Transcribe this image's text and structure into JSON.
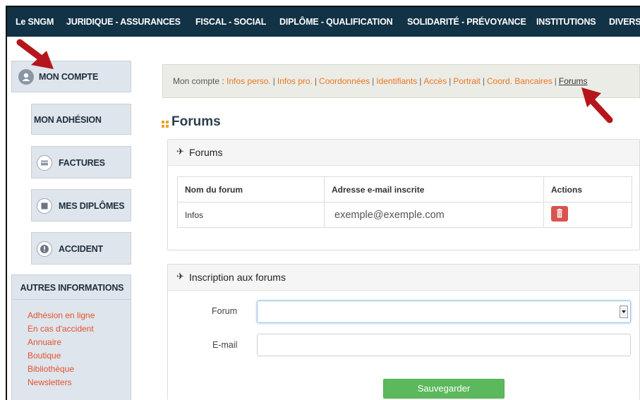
{
  "topnav": {
    "items": [
      "Le SNGM",
      "JURIDIQUE - ASSURANCES",
      "FISCAL - SOCIAL",
      "DIPLÔME - QUALIFICATION",
      "SOLIDARITÉ - PRÉVOYANCE",
      "INSTITUTIONS",
      "DIVERS"
    ]
  },
  "sidebar": {
    "account": "MON COMPTE",
    "adhesion": "MON ADHÉSION",
    "factures": "FACTURES",
    "diplomes": "MES DIPLÔMES",
    "accident": "ACCIDENT",
    "other_title": "AUTRES INFORMATIONS",
    "links": [
      "Adhésion en ligne",
      "En cas d'accident",
      "Annuaire",
      "Boutique",
      "Bibliothèque",
      "Newsletters"
    ]
  },
  "breadcrumb": {
    "prefix": "Mon compte :",
    "links": [
      "Infos perso.",
      "Infos pro.",
      "Coordonnées",
      "Identifiants",
      "Accès",
      "Portrait",
      "Coord. Bancaires"
    ],
    "current": "Forums"
  },
  "page": {
    "title": "Forums"
  },
  "forums_panel": {
    "title": "Forums",
    "headers": [
      "Nom du forum",
      "Adresse e-mail inscrite",
      "Actions"
    ],
    "rows": [
      {
        "forum": "Infos",
        "email": "exemple@exemple.com"
      }
    ]
  },
  "inscription_panel": {
    "title": "Inscription aux forums",
    "forum_label": "Forum",
    "forum_value": "",
    "email_label": "E-mail",
    "email_value": "",
    "save_label": "Sauvegarder"
  },
  "colors": {
    "nav_bg": "#123246",
    "link": "#e87622",
    "sidebar_link": "#e0542f",
    "arrow": "#b5161b",
    "save": "#5cb85c",
    "delete": "#d9534f"
  }
}
